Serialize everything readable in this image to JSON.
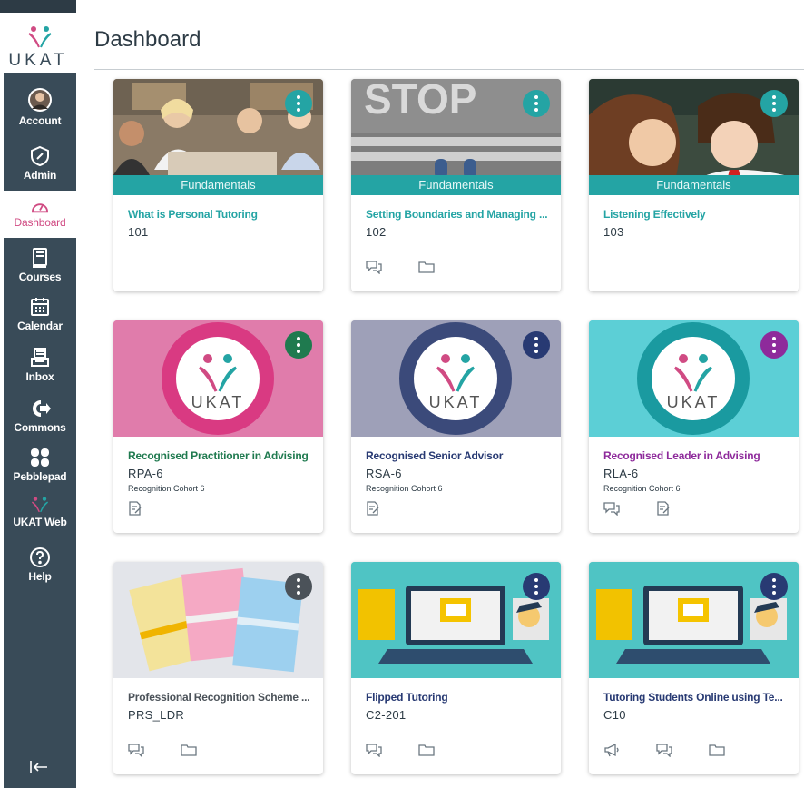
{
  "brand": {
    "logo_text": "UKAT"
  },
  "nav": {
    "items": [
      {
        "label": "Account"
      },
      {
        "label": "Admin"
      },
      {
        "label": "Dashboard"
      },
      {
        "label": "Courses"
      },
      {
        "label": "Calendar"
      },
      {
        "label": "Inbox"
      },
      {
        "label": "Commons"
      },
      {
        "label": "Pebblepad"
      },
      {
        "label": "UKAT Web"
      },
      {
        "label": "Help"
      }
    ],
    "collapse_icon": "collapse-icon",
    "colors": {
      "sidebar": "#394b58",
      "active_text": "#d04b83"
    }
  },
  "page": {
    "title": "Dashboard"
  },
  "cards": [
    {
      "title": "What is Personal Tutoring",
      "code": "101",
      "term": "",
      "band": "Fundamentals",
      "color": "#24a4a4",
      "image": "students-group-photo",
      "actions": []
    },
    {
      "title": "Setting Boundaries and Managing ...",
      "code": "102",
      "term": "",
      "band": "Fundamentals",
      "color": "#24a4a4",
      "image": "stop-road-photo",
      "actions": [
        "discussions-icon",
        "files-icon"
      ]
    },
    {
      "title": "Listening Effectively",
      "code": "103",
      "term": "",
      "band": "Fundamentals",
      "color": "#24a4a4",
      "image": "children-whisper-photo",
      "actions": []
    },
    {
      "title": "Recognised Practitioner in Advising",
      "code": "RPA-6",
      "term": "Recognition Cohort 6",
      "band": "",
      "color": "#1f7a4f",
      "image": "ukat-recognised-practitioner-badge",
      "actions": [
        "assignments-icon"
      ]
    },
    {
      "title": "Recognised Senior Advisor",
      "code": "RSA-6",
      "term": "Recognition Cohort 6",
      "band": "",
      "color": "#283a73",
      "image": "ukat-recognised-senior-badge",
      "actions": [
        "assignments-icon"
      ]
    },
    {
      "title": "Recognised Leader in Advising",
      "code": "RLA-6",
      "term": "Recognition Cohort 6",
      "band": "",
      "color": "#8e2a9b",
      "image": "ukat-recognised-leader-badge",
      "actions": [
        "discussions-icon",
        "assignments-icon"
      ]
    },
    {
      "title": "Professional Recognition Scheme ...",
      "code": "PRS_LDR",
      "term": "",
      "band": "",
      "color": "#4b5259",
      "image": "notebooks-photo",
      "actions": [
        "discussions-icon",
        "files-icon"
      ]
    },
    {
      "title": "Flipped Tutoring",
      "code": "C2-201",
      "term": "",
      "band": "",
      "color": "#283a73",
      "image": "elearning-illustration",
      "actions": [
        "discussions-icon",
        "files-icon"
      ]
    },
    {
      "title": "Tutoring Students Online using Te...",
      "code": "C10",
      "term": "",
      "band": "",
      "color": "#283a73",
      "image": "elearning-illustration",
      "actions": [
        "announcements-icon",
        "discussions-icon",
        "files-icon"
      ]
    }
  ]
}
